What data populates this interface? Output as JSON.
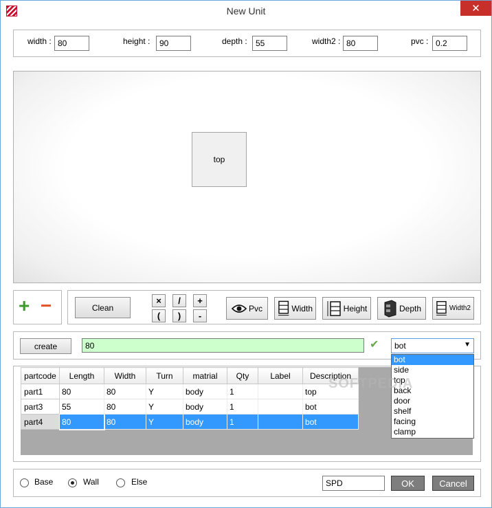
{
  "window": {
    "title": "New Unit",
    "close": "✕"
  },
  "dims": {
    "width": {
      "label": "width :",
      "value": "80"
    },
    "height": {
      "label": "height :",
      "value": "90"
    },
    "depth": {
      "label": "depth :",
      "value": "55"
    },
    "width2": {
      "label": "width2 :",
      "value": "80"
    },
    "pvc": {
      "label": "pvc :",
      "value": "0.2"
    }
  },
  "preview": {
    "part_label": "top"
  },
  "toolbar": {
    "add_icon": "+",
    "remove_icon": "−",
    "clean": "Clean",
    "ops": [
      "×",
      "/",
      "+",
      "(",
      ")",
      "-"
    ],
    "pvc": "Pvc",
    "width": "Width",
    "height": "Height",
    "depth": "Depth",
    "width2": "Width2"
  },
  "formula": {
    "create": "create",
    "value": "80",
    "check": "✔",
    "select_value": "bot",
    "options": [
      "bot",
      "side",
      "top",
      "back",
      "door",
      "shelf",
      "facing",
      "clamp"
    ]
  },
  "grid": {
    "columns": [
      "partcode",
      "Length",
      "Width",
      "Turn",
      "matrial",
      "Qty",
      "Label",
      "Description"
    ],
    "rows": [
      [
        "part1",
        "80",
        "80",
        "Y",
        "body",
        "1",
        "",
        "top"
      ],
      [
        "part3",
        "55",
        "80",
        "Y",
        "body",
        "1",
        "",
        "bot"
      ],
      [
        "part4",
        "80",
        "80",
        "Y",
        "body",
        "1",
        "",
        "bot"
      ]
    ],
    "selected_row": 2
  },
  "watermark": "SOFTPEDIA",
  "footer": {
    "options": [
      "Base",
      "Wall",
      "Else"
    ],
    "selected": "Wall",
    "code": "SPD",
    "ok": "OK",
    "cancel": "Cancel"
  }
}
